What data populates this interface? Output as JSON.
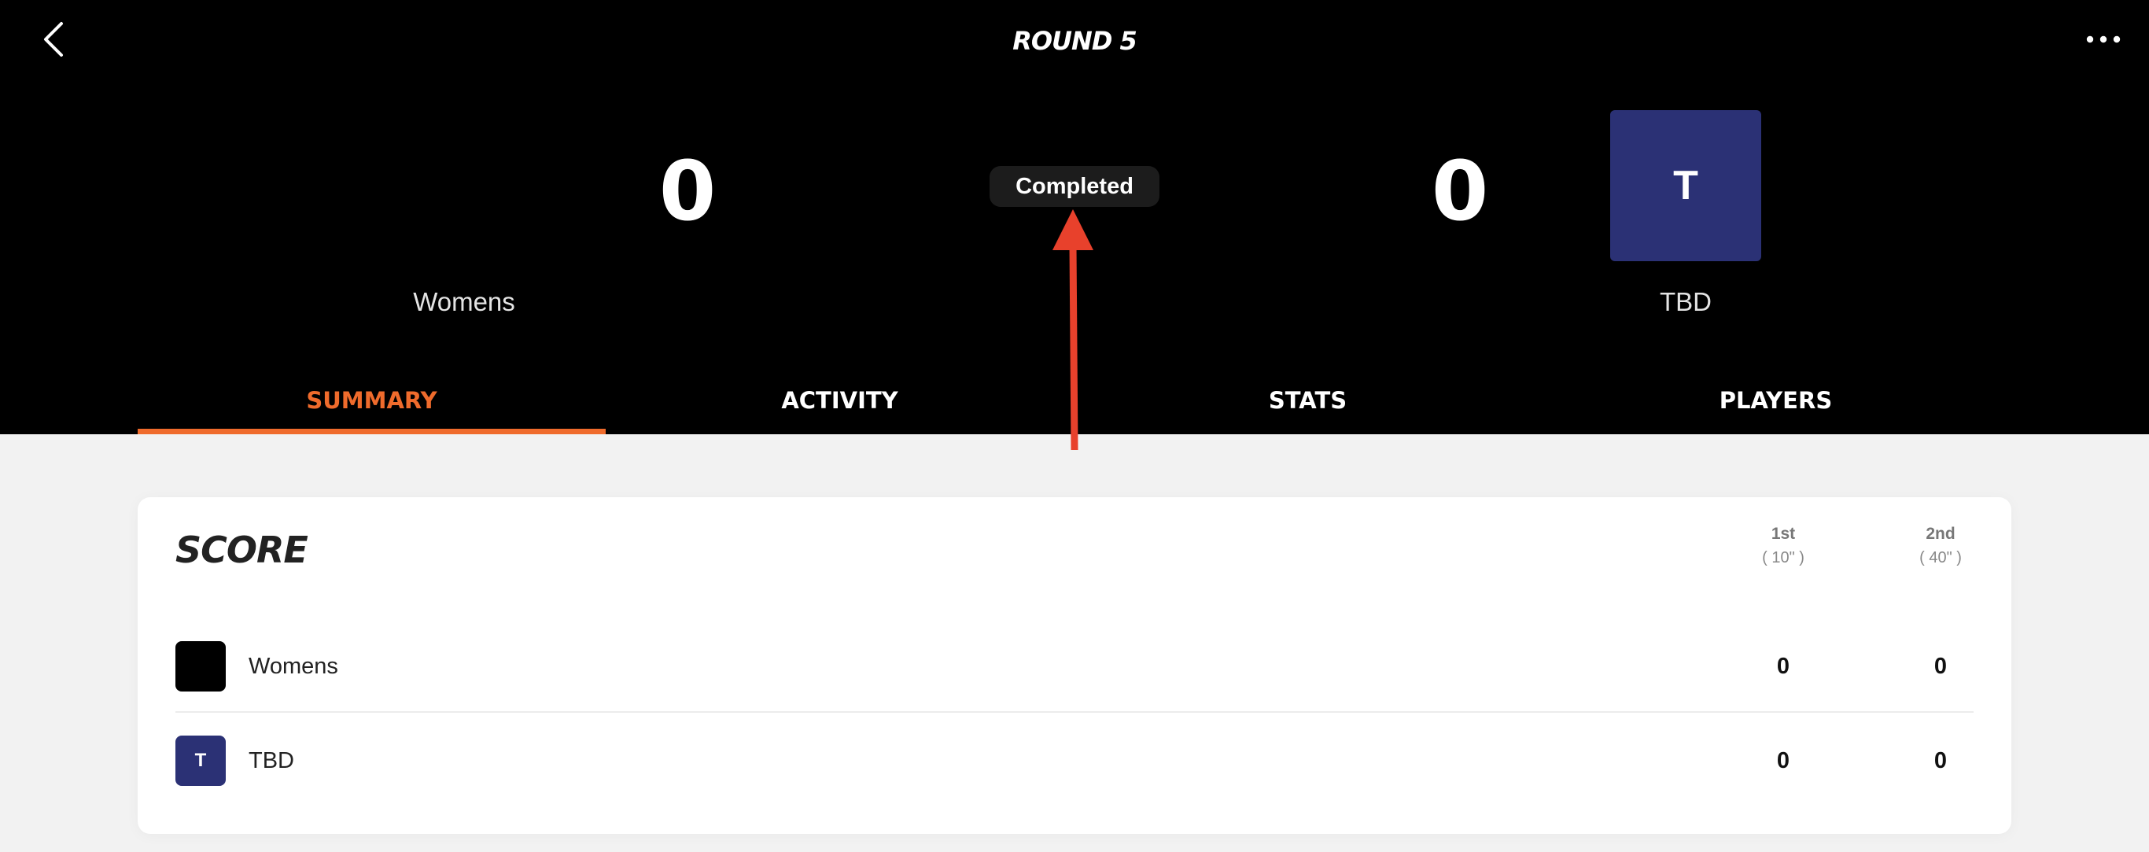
{
  "header": {
    "title": "ROUND 5",
    "status": "Completed",
    "home": {
      "name": "Womens",
      "score": "0"
    },
    "away": {
      "name": "TBD",
      "score": "0",
      "logo_letter": "T"
    }
  },
  "tabs": [
    {
      "label": "SUMMARY",
      "active": true
    },
    {
      "label": "ACTIVITY",
      "active": false
    },
    {
      "label": "STATS",
      "active": false
    },
    {
      "label": "PLAYERS",
      "active": false
    }
  ],
  "score_card": {
    "title": "SCORE",
    "periods": [
      {
        "name": "1st",
        "duration": "( 10\" )"
      },
      {
        "name": "2nd",
        "duration": "( 40\" )"
      }
    ],
    "rows": [
      {
        "team": "Womens",
        "logo_letter": "",
        "logo_color": "#000000",
        "scores": [
          "0",
          "0"
        ]
      },
      {
        "team": "TBD",
        "logo_letter": "T",
        "logo_color": "#2b3175",
        "scores": [
          "0",
          "0"
        ]
      }
    ]
  },
  "colors": {
    "accent": "#ef6b2c",
    "team_tbd": "#2b3175",
    "annotation_arrow": "#e8412c"
  },
  "icons": {
    "back": "chevron-left-icon",
    "more": "more-horizontal-icon"
  }
}
